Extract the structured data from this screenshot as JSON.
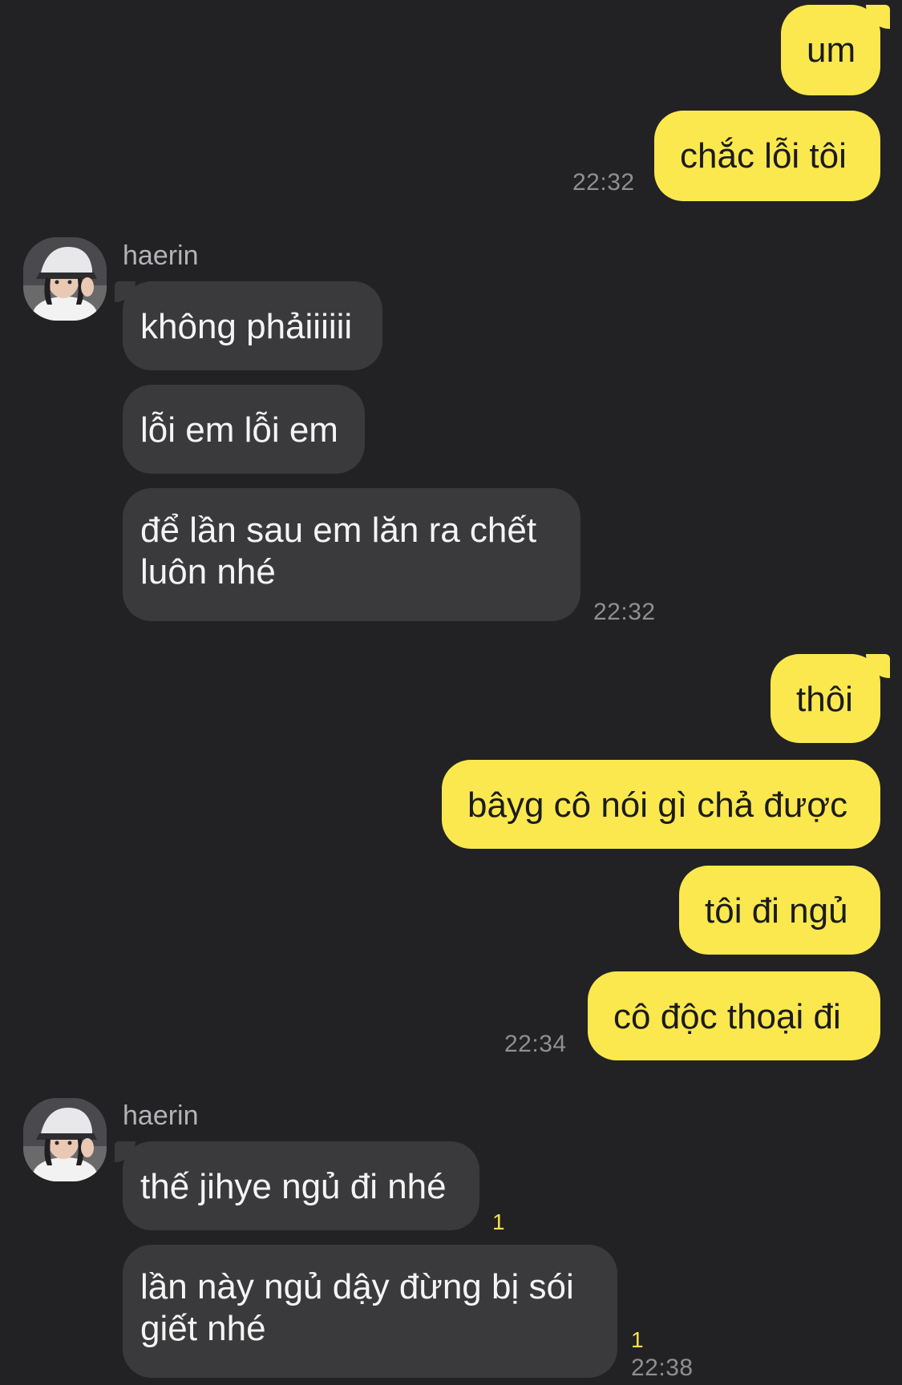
{
  "chat": {
    "messages": [
      {
        "side": "out",
        "text": "um"
      },
      {
        "side": "out",
        "text": "chắc lỗi tôi",
        "time": "22:32"
      },
      {
        "side": "in",
        "sender": "haerin",
        "text": "không phảiiiiii"
      },
      {
        "side": "in",
        "text": "lỗi em lỗi em"
      },
      {
        "side": "in",
        "text": "để lần sau em lăn ra chết luôn nhé",
        "time": "22:32"
      },
      {
        "side": "out",
        "text": "thôi"
      },
      {
        "side": "out",
        "text": "bâyg cô nói gì chả được"
      },
      {
        "side": "out",
        "text": "tôi đi ngủ"
      },
      {
        "side": "out",
        "text": "cô độc thoại đi",
        "time": "22:34"
      },
      {
        "side": "in",
        "sender": "haerin",
        "text": "thế jihye ngủ đi nhé",
        "unread": "1"
      },
      {
        "side": "in",
        "text": "lần này ngủ dậy đừng bị sói giết nhé",
        "unread": "1",
        "time": "22:38"
      }
    ]
  },
  "colors": {
    "background": "#222224",
    "outgoing_bubble": "#fae84e",
    "incoming_bubble": "#3a3a3d",
    "unread_count": "#f6e04a"
  },
  "icons": {
    "avatar": "profile-photo"
  }
}
